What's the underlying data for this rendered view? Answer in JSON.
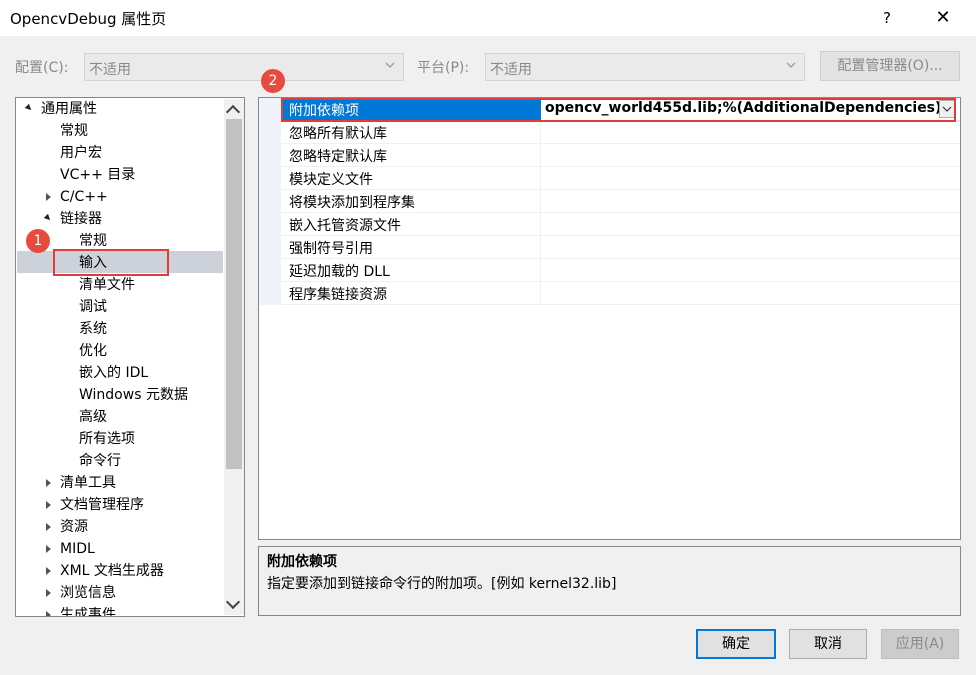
{
  "window": {
    "title": "OpencvDebug 属性页",
    "help": "?",
    "close": "✕"
  },
  "config_bar": {
    "config_label": "配置(C):",
    "config_value": "不适用",
    "platform_label": "平台(P):",
    "platform_value": "不适用",
    "config_manager": "配置管理器(O)..."
  },
  "tree": {
    "items": [
      {
        "label": "通用属性"
      },
      {
        "label": "常规"
      },
      {
        "label": "用户宏"
      },
      {
        "label": "VC++ 目录"
      },
      {
        "label": "C/C++"
      },
      {
        "label": "链接器"
      },
      {
        "label": "常规"
      },
      {
        "label": "输入"
      },
      {
        "label": "清单文件"
      },
      {
        "label": "调试"
      },
      {
        "label": "系统"
      },
      {
        "label": "优化"
      },
      {
        "label": "嵌入的 IDL"
      },
      {
        "label": "Windows 元数据"
      },
      {
        "label": "高级"
      },
      {
        "label": "所有选项"
      },
      {
        "label": "命令行"
      },
      {
        "label": "清单工具"
      },
      {
        "label": "文档管理程序"
      },
      {
        "label": "资源"
      },
      {
        "label": "MIDL"
      },
      {
        "label": "XML 文档生成器"
      },
      {
        "label": "浏览信息"
      },
      {
        "label": "生成事件"
      }
    ]
  },
  "properties": {
    "rows": [
      {
        "name": "附加依赖项",
        "value": "opencv_world455d.lib;%(AdditionalDependencies)"
      },
      {
        "name": "忽略所有默认库",
        "value": ""
      },
      {
        "name": "忽略特定默认库",
        "value": ""
      },
      {
        "name": "模块定义文件",
        "value": ""
      },
      {
        "name": "将模块添加到程序集",
        "value": ""
      },
      {
        "name": "嵌入托管资源文件",
        "value": ""
      },
      {
        "name": "强制符号引用",
        "value": ""
      },
      {
        "name": "延迟加载的 DLL",
        "value": ""
      },
      {
        "name": "程序集链接资源",
        "value": ""
      }
    ]
  },
  "description": {
    "title": "附加依赖项",
    "text": "指定要添加到链接命令行的附加项。[例如 kernel32.lib]"
  },
  "buttons": {
    "ok": "确定",
    "cancel": "取消",
    "apply": "应用(A)"
  },
  "annotations": {
    "badge1": "1",
    "badge2": "2",
    "highlight_color": "#e03c3c"
  }
}
